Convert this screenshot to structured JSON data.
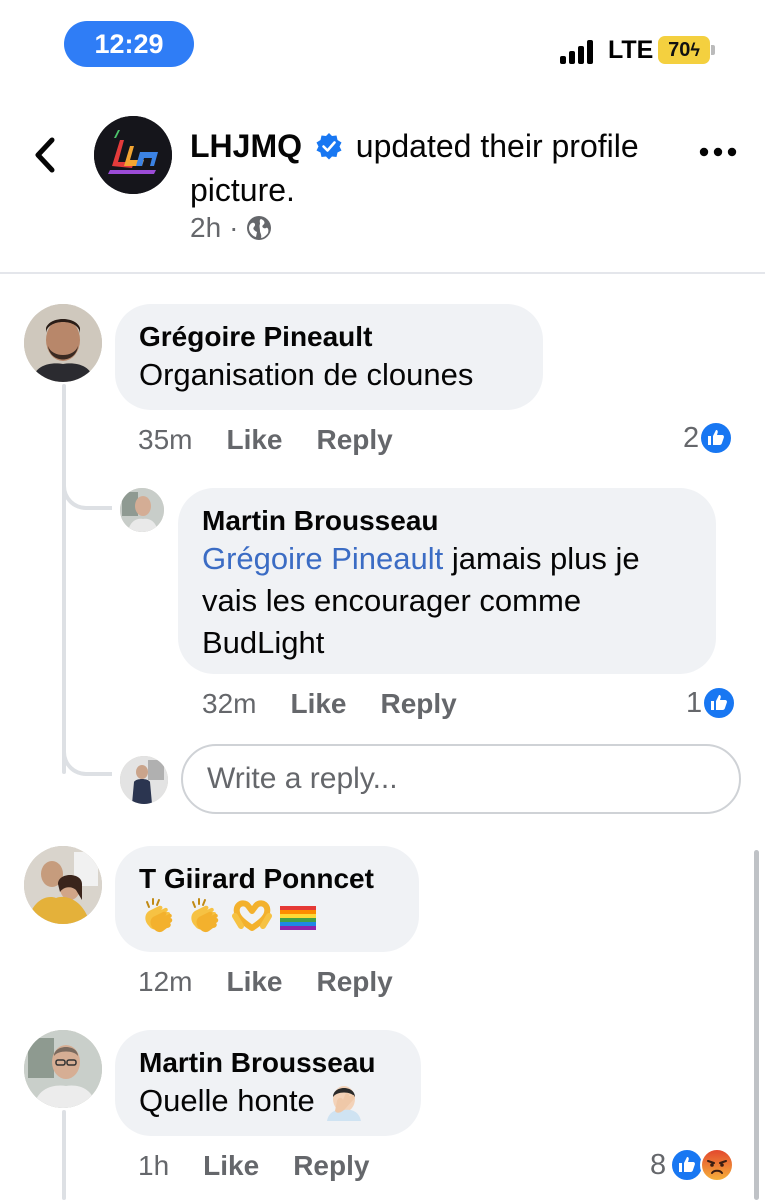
{
  "status_bar": {
    "time": "12:29",
    "network": "LTE",
    "battery": "70"
  },
  "post": {
    "page_name": "LHJMQ",
    "action_text": "updated their profile picture.",
    "time": "2h",
    "separator": "·"
  },
  "comments": [
    {
      "author": "Grégoire Pineault",
      "text": "Organisation de clounes",
      "time": "35m",
      "like_label": "Like",
      "reply_label": "Reply",
      "reaction_count": "2",
      "replies": [
        {
          "author": "Martin Brousseau",
          "mention": "Grégoire Pineault",
          "text_line1": " jamais plus je",
          "text_line2": "vais les encourager comme",
          "text_line3": "BudLight",
          "time": "32m",
          "like_label": "Like",
          "reply_label": "Reply",
          "reaction_count": "1"
        }
      ],
      "reply_placeholder": "Write a reply..."
    },
    {
      "author": "T Giirard Ponncet",
      "emojis": [
        "clapping-hands",
        "clapping-hands",
        "heart-hands",
        "rainbow-flag"
      ],
      "time": "12m",
      "like_label": "Like",
      "reply_label": "Reply"
    },
    {
      "author": "Martin Brousseau",
      "text": "Quelle honte",
      "emoji": "facepalm",
      "time": "1h",
      "like_label": "Like",
      "reply_label": "Reply",
      "reaction_count": "8"
    }
  ],
  "colors": {
    "accent": "#1877f2",
    "mention": "#3b6cc4",
    "bubble": "#f0f2f5",
    "secondary_text": "#65676b",
    "time_pill": "#2f7df6",
    "battery": "#f4d03f"
  }
}
